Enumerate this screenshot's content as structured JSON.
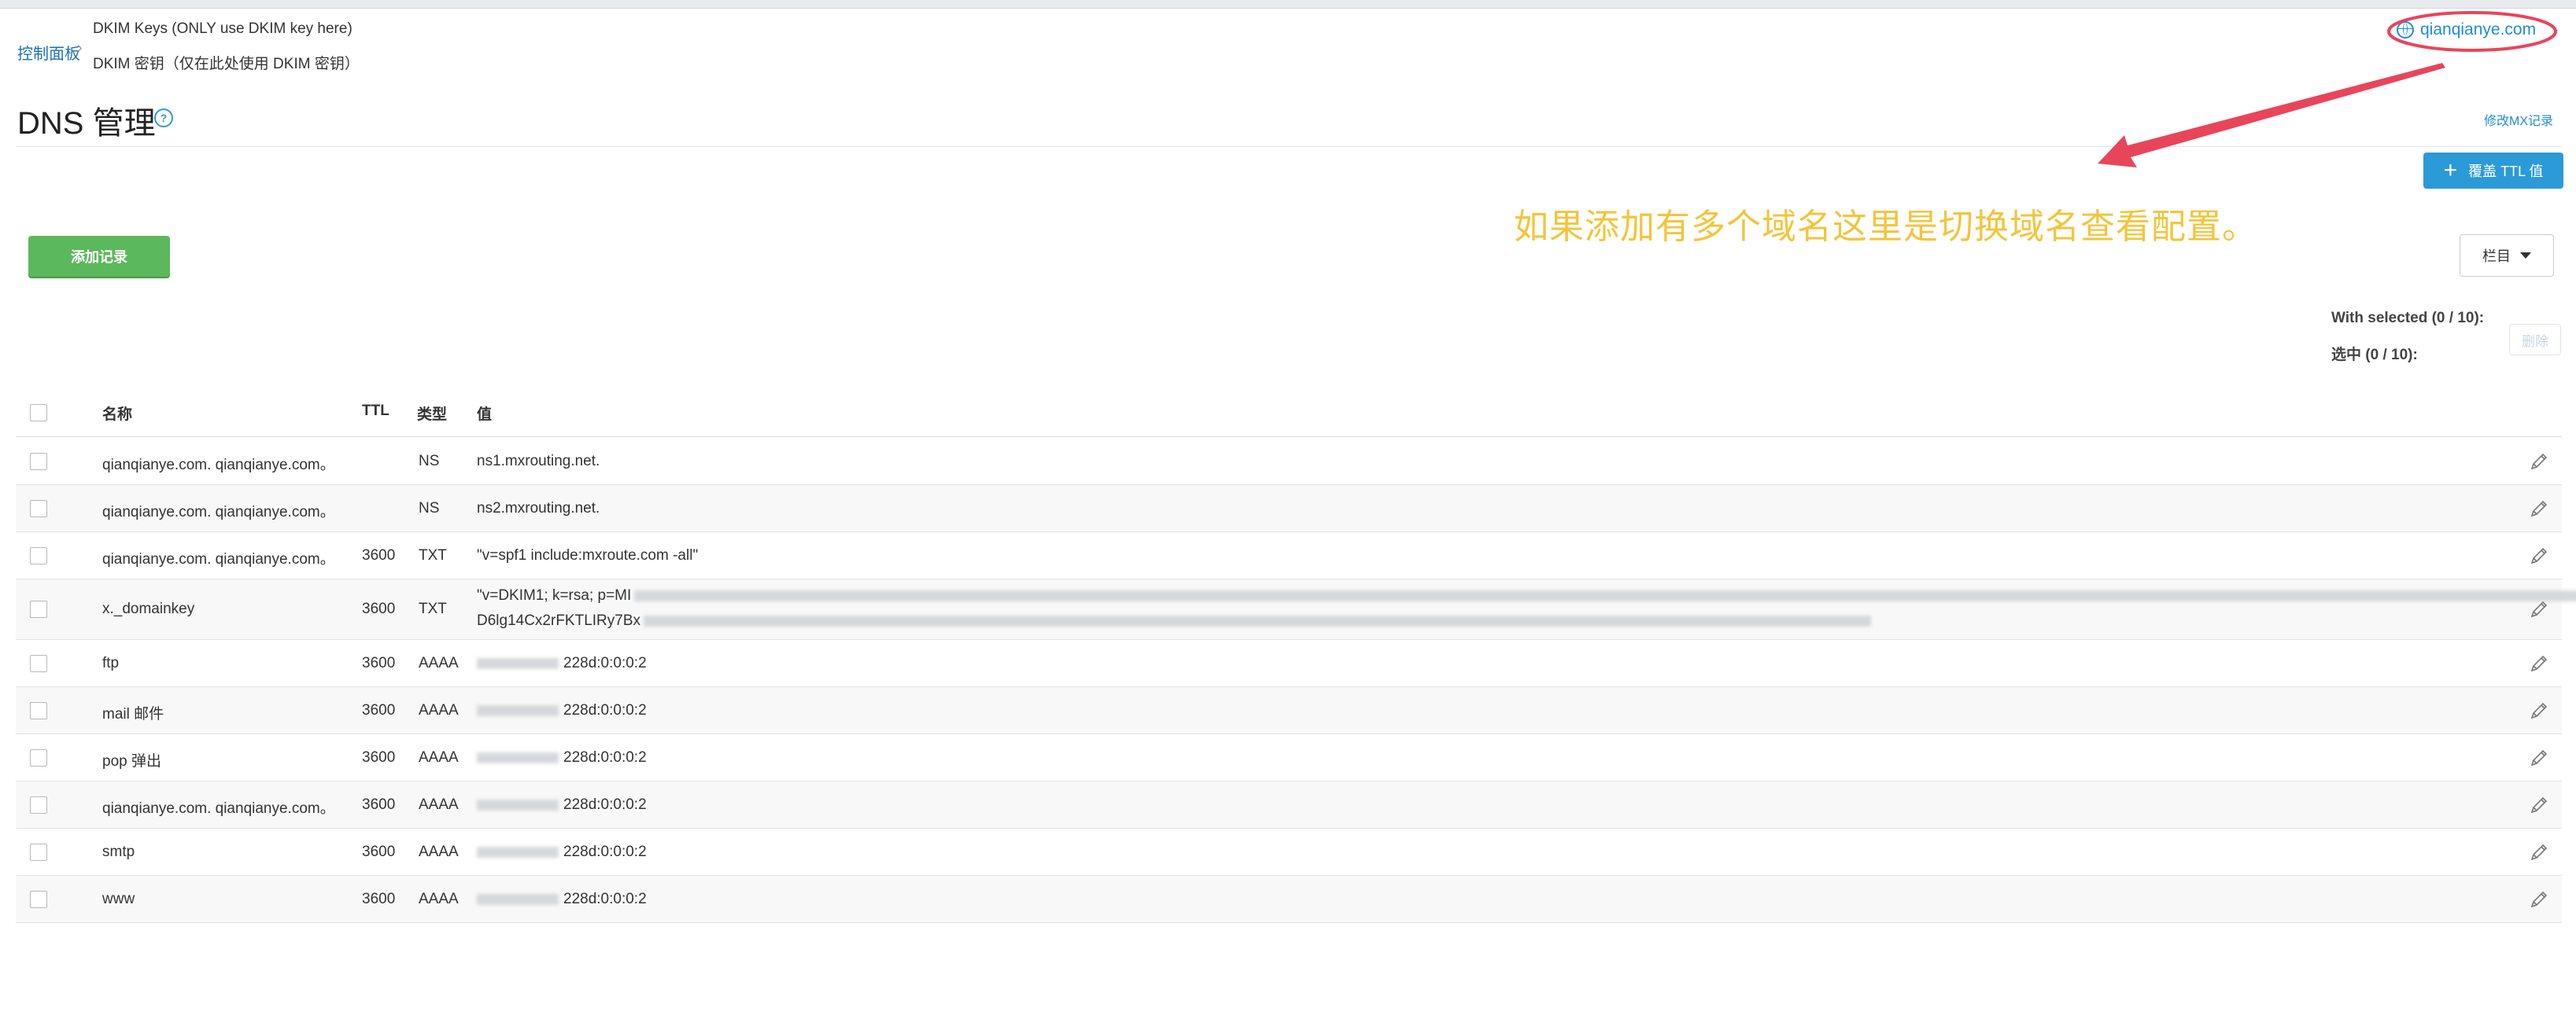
{
  "breadcrumb": {
    "root": "控制面板",
    "separator": "›",
    "current_en": "DKIM Keys (ONLY use DKIM key here)",
    "current_cn": "DKIM 密钥（仅在此处使用 DKIM 密钥）"
  },
  "page": {
    "title": "DNS 管理",
    "help": "?"
  },
  "domain_switch": {
    "label": "qianqianye.com",
    "icon": "globe-icon"
  },
  "actions": {
    "modify_mx": "修改MX记录",
    "override_ttl": "覆盖 TTL 值",
    "add_record": "添加记录",
    "columns": "栏目",
    "with_selected_en": "With selected (0 / 10):",
    "with_selected_cn": "选中 (0 / 10):",
    "delete": "删除"
  },
  "annotation": {
    "text": "如果添加有多个域名这里是切换域名查看配置。",
    "color": "#f2c53d"
  },
  "colors": {
    "accent": "#2b9ad6",
    "add_button": "#5cb85c",
    "highlight_ring": "#e8455a"
  },
  "table": {
    "headers": {
      "name": "名称",
      "ttl": "TTL",
      "type": "类型",
      "value": "值"
    },
    "rows": [
      {
        "name": "qianqianye.com.  qianqianye.com。",
        "ttl": "",
        "type": "NS",
        "value": "ns1.mxrouting.net."
      },
      {
        "name": "qianqianye.com.  qianqianye.com。",
        "ttl": "",
        "type": "NS",
        "value": "ns2.mxrouting.net."
      },
      {
        "name": "qianqianye.com.  qianqianye.com。",
        "ttl": "3600",
        "type": "TXT",
        "value": "\"v=spf1 include:mxroute.com -all\""
      },
      {
        "name": "x._domainkey",
        "ttl": "3600",
        "type": "TXT",
        "value": "\"v=DKIM1; k=rsa; p=MI",
        "value2": "D6lg14Cx2rFKTLIRy7Bx"
      },
      {
        "name": "ftp",
        "ttl": "3600",
        "type": "AAAA",
        "value": "228d:0:0:0:2"
      },
      {
        "name": "mail  邮件",
        "ttl": "3600",
        "type": "AAAA",
        "value": "228d:0:0:0:2"
      },
      {
        "name": "pop  弹出",
        "ttl": "3600",
        "type": "AAAA",
        "value": "228d:0:0:0:2"
      },
      {
        "name": "qianqianye.com.  qianqianye.com。",
        "ttl": "3600",
        "type": "AAAA",
        "value": "228d:0:0:0:2"
      },
      {
        "name": "smtp",
        "ttl": "3600",
        "type": "AAAA",
        "value": "228d:0:0:0:2"
      },
      {
        "name": "www",
        "ttl": "3600",
        "type": "AAAA",
        "value": "228d:0:0:0:2"
      }
    ]
  }
}
